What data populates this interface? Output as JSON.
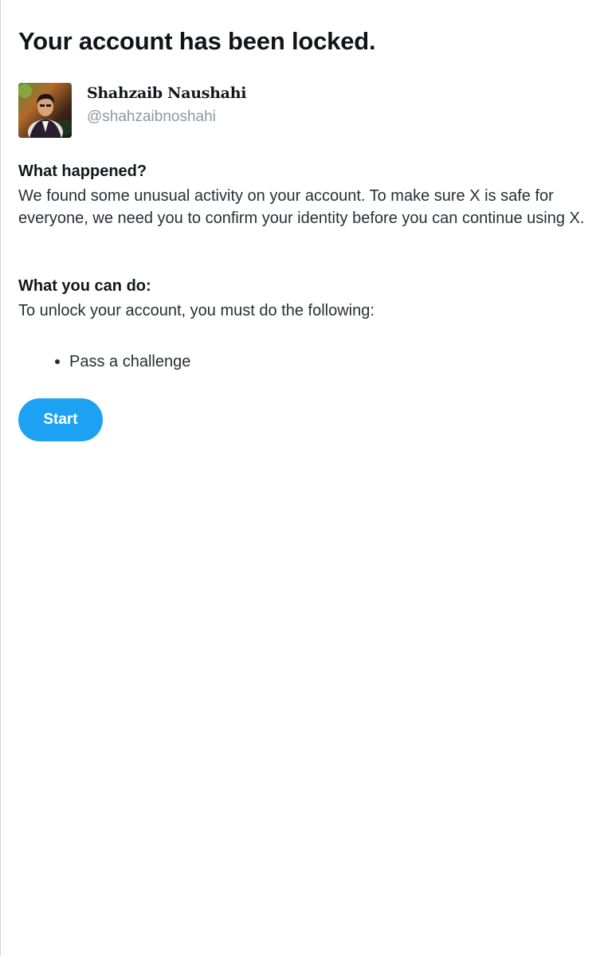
{
  "page": {
    "title": "Your account has been locked."
  },
  "profile": {
    "name": "Shahzaib Naushahi",
    "handle": "@shahzaibnoshahi"
  },
  "what_happened": {
    "heading": "What happened?",
    "text": "We found some unusual activity on your account. To make sure X is safe for everyone, we need you to confirm your identity before you can continue using X."
  },
  "what_you_can_do": {
    "heading": "What you can do:",
    "text": "To unlock your account, you must do the following:",
    "items": [
      "Pass a challenge"
    ]
  },
  "actions": {
    "start_label": "Start"
  },
  "colors": {
    "accent": "#1da1f2",
    "text_primary": "#14171a",
    "text_secondary": "#8899a6"
  }
}
